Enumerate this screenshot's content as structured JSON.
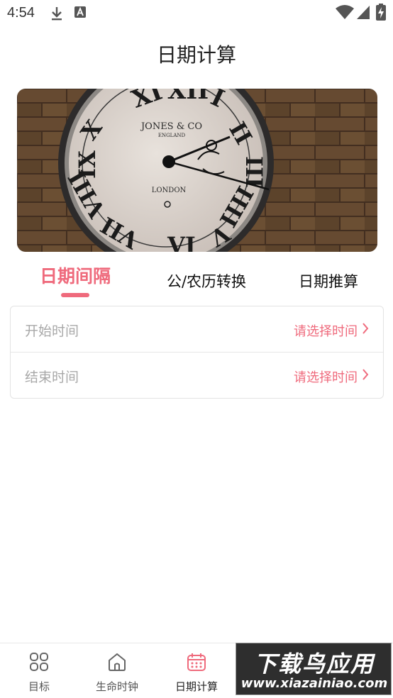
{
  "status_bar": {
    "time": "4:54",
    "icons": [
      "download-icon",
      "accessibility-a-icon",
      "wifi-icon",
      "signal-icon",
      "battery-charging-icon"
    ]
  },
  "header": {
    "title": "日期计算"
  },
  "banner": {
    "image": "wall-clock-photo",
    "clock_brand": "JONES & CO",
    "clock_origin": "ENGLAND",
    "clock_city": "LONDON"
  },
  "tabs": [
    {
      "label": "日期间隔",
      "active": true
    },
    {
      "label": "公/农历转换",
      "active": false
    },
    {
      "label": "日期推算",
      "active": false
    }
  ],
  "form": {
    "rows": [
      {
        "label": "开始时间",
        "value": "请选择时间"
      },
      {
        "label": "结束时间",
        "value": "请选择时间"
      }
    ]
  },
  "bottom_nav": {
    "items": [
      {
        "label": "目标",
        "icon": "grid-icon"
      },
      {
        "label": "生命时钟",
        "icon": "home-icon"
      },
      {
        "label": "日期计算",
        "icon": "calendar-icon",
        "active": true
      }
    ]
  },
  "watermark": {
    "title": "下载鸟应用",
    "url": "www.xiazainiao.com"
  },
  "colors": {
    "accent": "#ef6a7c",
    "placeholder": "#a8a8a8",
    "border": "#e3e3e3"
  }
}
